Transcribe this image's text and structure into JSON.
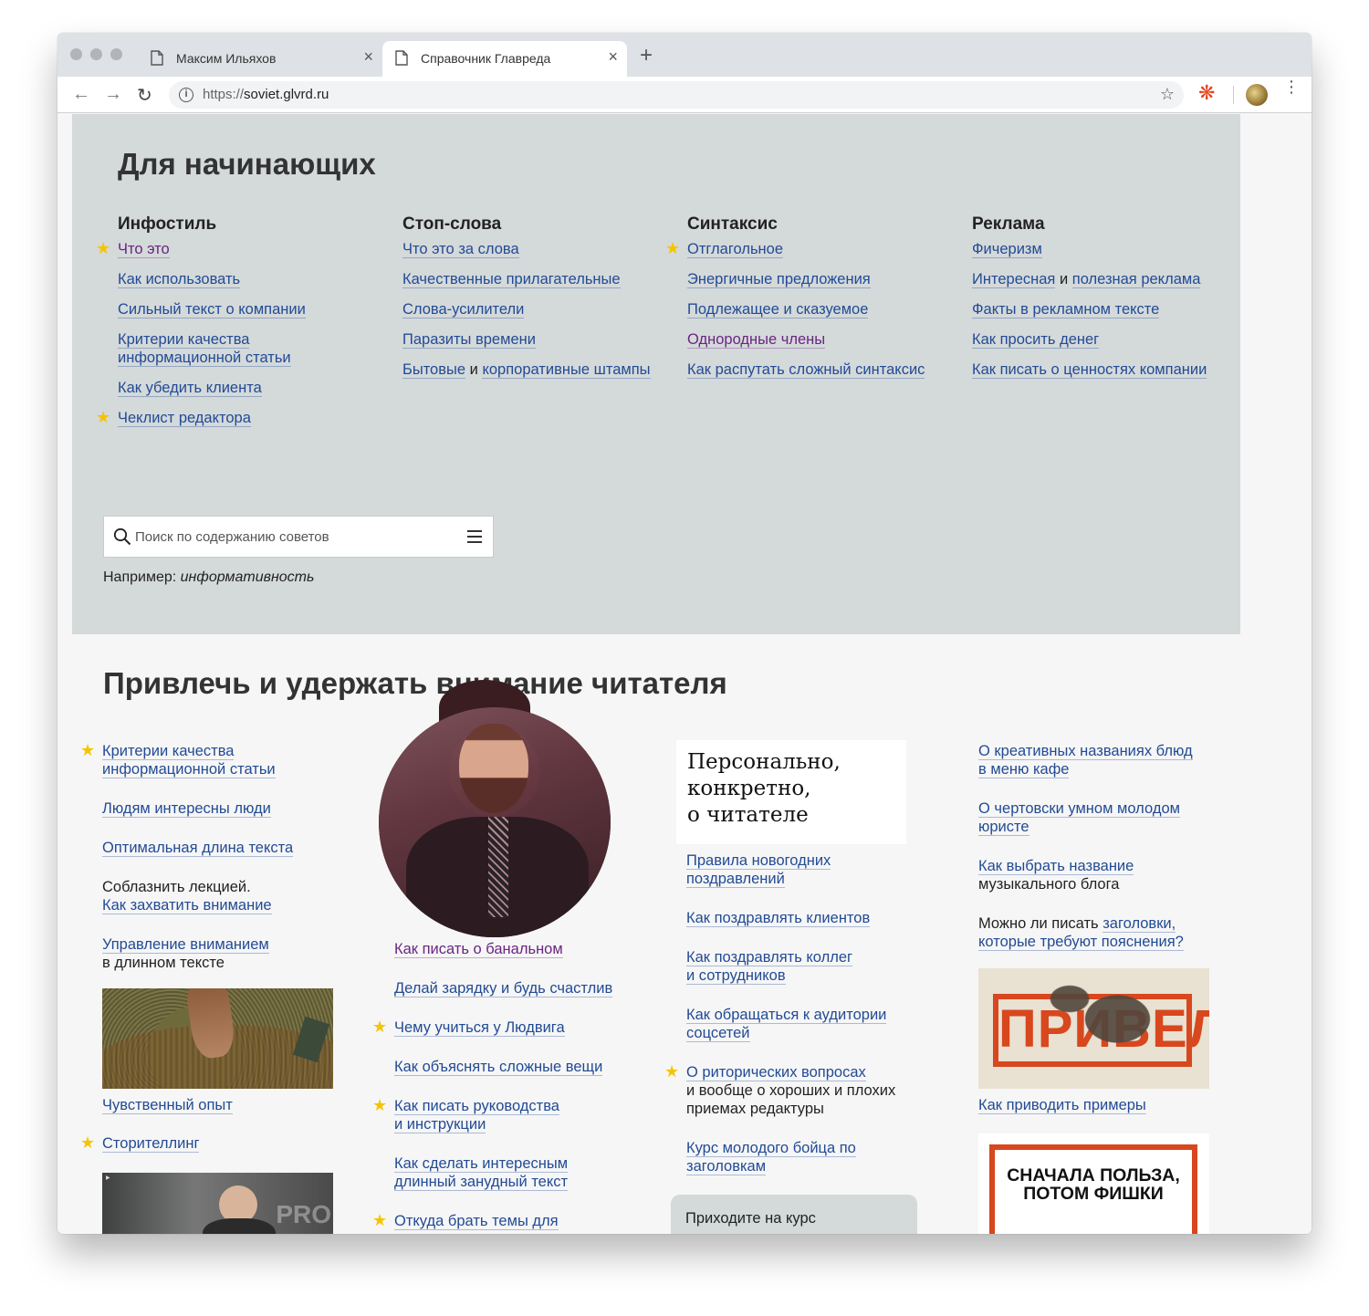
{
  "browser": {
    "tabs": [
      {
        "title": "Максим Ильяхов",
        "active": false
      },
      {
        "title": "Справочник Главреда",
        "active": true
      }
    ],
    "url_scheme": "https://",
    "url_host": "soviet.glvrd.ru",
    "tab_close": "×",
    "new_tab": "+"
  },
  "beginners": {
    "heading": "Для начинающих",
    "columns": [
      {
        "title": "Инфостиль",
        "links": [
          {
            "text": "Что это",
            "starred": true,
            "visited": true
          },
          {
            "text": "Как использовать"
          },
          {
            "text": "Сильный текст о компании"
          },
          {
            "text": "Критерии качества информационной статьи"
          },
          {
            "text": "Как убедить клиента"
          },
          {
            "text": "Чеклист редактора",
            "starred": true
          }
        ]
      },
      {
        "title": "Стоп-слова",
        "links": [
          {
            "text": "Что это за слова"
          },
          {
            "text": "Качественные прилагательные"
          },
          {
            "text": "Слова-усилители"
          },
          {
            "text": "Паразиты времени"
          },
          {
            "text_a": "Бытовые",
            "joiner": "и",
            "text_b": "корпоративные штампы"
          }
        ]
      },
      {
        "title": "Синтаксис",
        "links": [
          {
            "text": "Отглагольное",
            "starred": true
          },
          {
            "text": "Энергичные предложения"
          },
          {
            "text": "Подлежащее и сказуемое"
          },
          {
            "text": "Однородные члены",
            "visited": true
          },
          {
            "text": "Как распутать сложный синтаксис"
          }
        ]
      },
      {
        "title": "Реклама",
        "links": [
          {
            "text": "Фичеризм"
          },
          {
            "text_a": "Интересная",
            "joiner": "и",
            "text_b": "полезная реклама"
          },
          {
            "text": "Факты в рекламном тексте"
          },
          {
            "text": "Как просить денег"
          },
          {
            "text": "Как писать о ценностях компании"
          }
        ]
      }
    ],
    "search": {
      "placeholder": "Поиск по содержанию советов",
      "example_label": "Например:",
      "example_value": "информативность"
    }
  },
  "attention": {
    "heading": "Привлечь и удержать внимание читателя",
    "col1": [
      {
        "text_a": "Критерии качества",
        "text_b": "информационной статьи",
        "starred": true
      },
      {
        "text": "Людям интересны люди"
      },
      {
        "text": "Оптимальная длина текста"
      },
      {
        "prefix": "Соблазнить лекцией.",
        "text": "Как захватить внимание"
      },
      {
        "text": "Управление вниманием",
        "suffix": "в длинном тексте"
      },
      {
        "text": "Чувственный опыт"
      },
      {
        "text": "Сторителлинг",
        "starred": true
      }
    ],
    "col2": [
      {
        "text": "Как писать о банальном",
        "visited": true
      },
      {
        "text": "Делай зарядку и будь счастлив"
      },
      {
        "text": "Чему учиться у Людвига",
        "starred": true
      },
      {
        "text": "Как объяснять сложные вещи"
      },
      {
        "text_a": "Как писать руководства",
        "text_b": "и инструкции",
        "starred": true
      },
      {
        "text_a": "Как сделать интересным",
        "text_b": "длинный занудный текст"
      },
      {
        "text": "Откуда брать темы для",
        "starred": true
      }
    ],
    "quote_card": [
      "Персонально,",
      "конкретно,",
      "о читателе"
    ],
    "col3": [
      {
        "text_a": "Правила новогодних",
        "text_b": "поздравлений"
      },
      {
        "text": "Как поздравлять клиентов"
      },
      {
        "text_a": "Как поздравлять коллег",
        "text_b": "и сотрудников"
      },
      {
        "text_a": "Как обращаться к аудитории",
        "text_b": "соцсетей"
      },
      {
        "text": "О риторических вопросах",
        "suffix_a": "и вообще о хороших и плохих",
        "suffix_b": "приемах редактуры",
        "starred": true
      },
      {
        "text_a": "Курс молодого бойца по",
        "text_b": "заголовкам"
      }
    ],
    "course_banner": "Приходите на курс",
    "col4": [
      {
        "text_a": "О креативных названиях блюд",
        "text_b": "в меню кафе"
      },
      {
        "text_a": "О чертовски умном молодом",
        "text_b": "юристе"
      },
      {
        "text": "Как выбрать название",
        "suffix": "музыкального блога"
      },
      {
        "prefix": "Можно ли писать",
        "text_a": "заголовки,",
        "text_b": "которые требуют пояснения?"
      },
      {
        "text": "Как приводить примеры"
      }
    ],
    "horse_image_word": "ПРИВЕЛ",
    "poster_text": [
      "СНАЧАЛА ПОЛЬЗА,",
      "ПОТОМ ФИШКИ"
    ]
  },
  "colors": {
    "link": "#224b95",
    "visited": "#6a2582",
    "star": "#f5c400",
    "panel": "#d4d9da",
    "accent_orange": "#d8471d"
  },
  "icons": [
    "document-icon",
    "close-icon",
    "plus-icon",
    "back-arrow-icon",
    "forward-arrow-icon",
    "reload-icon",
    "info-icon",
    "bookmark-star-icon",
    "extension-icon",
    "profile-avatar-icon",
    "kebab-menu-icon",
    "search-icon",
    "hamburger-icon",
    "star-icon"
  ]
}
